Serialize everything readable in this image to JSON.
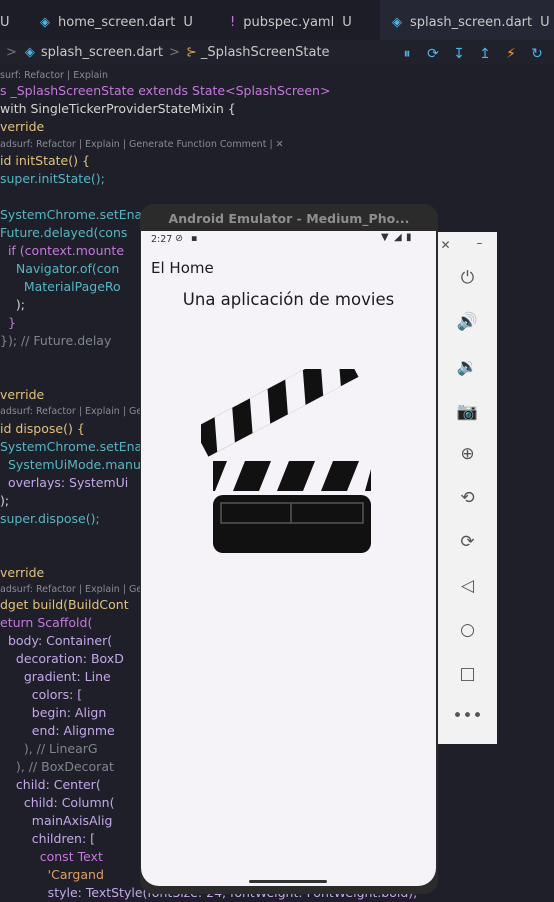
{
  "tabs": [
    {
      "icon": "dart-icon",
      "label": "",
      "suffix": "U"
    },
    {
      "icon": "dart-icon",
      "label": "home_screen.dart",
      "suffix": "U"
    },
    {
      "icon": "yaml-icon",
      "label": "pubspec.yaml",
      "suffix": "U"
    },
    {
      "icon": "dart-icon",
      "label": "splash_screen.dart",
      "suffix": "U"
    }
  ],
  "breadcrumb": {
    "file": "splash_screen.dart",
    "separator": ">",
    "symbol": "_SplashScreenState"
  },
  "hints": {
    "refactor_explain": "surf: Refactor | Explain",
    "generate": "adsurf: Refactor | Explain | Generate Function Comment | ✕",
    "dispose": "adsurf: Refactor | Explain | Ge",
    "build": "adsurf: Refactor | Explain | Ge"
  },
  "code": [
    "s _SplashScreenState extends State<SplashScreen>",
    "with SingleTickerProviderStateMixin {",
    "verride",
    "id initState() {",
    "super.initState();",
    "",
    "SystemChrome.setEnab",
    "Future.delayed(cons",
    "  if (context.mounte",
    "    Navigator.of(con",
    "      MaterialPageRo",
    "    );",
    "  }",
    "}); // Future.delay",
    "",
    "",
    "verride",
    "id dispose() {",
    "SystemChrome.setEnab",
    "  SystemUiMode.manua",
    "  overlays: SystemUi",
    ");",
    "super.dispose();",
    "",
    "",
    "verride",
    "dget build(BuildCont",
    "eturn Scaffold(",
    "  body: Container(",
    "    decoration: BoxD",
    "      gradient: Line",
    "        colors: [",
    "        begin: Align",
    "        end: Alignme",
    "      ), // LinearG",
    "    ), // BoxDecorat",
    "    child: Center(",
    "      child: Column(",
    "        mainAxisAlig",
    "        children: [",
    "          const Text",
    "            'Cargand",
    "            style: TextStyle(fontSize: 24, fontWeight: FontWeight.bold),"
  ],
  "emulator": {
    "title": "Android Emulator - Medium_Pho...",
    "time": "2:27",
    "app_title": "El Home",
    "subtitle": "Una aplicación de movies",
    "side_icons": [
      "close-icon",
      "minimize-icon",
      "power-icon",
      "volume-up-icon",
      "volume-down-icon",
      "camera-icon",
      "zoom-icon",
      "rotate-left-icon",
      "rotate-right-icon",
      "back-icon",
      "home-icon",
      "overview-icon",
      "more-icon"
    ]
  },
  "colors": {
    "editor_bg": "#1e1f29",
    "phone_bg": "#f6f3f8",
    "emulator_frame": "#2b2b2b"
  }
}
